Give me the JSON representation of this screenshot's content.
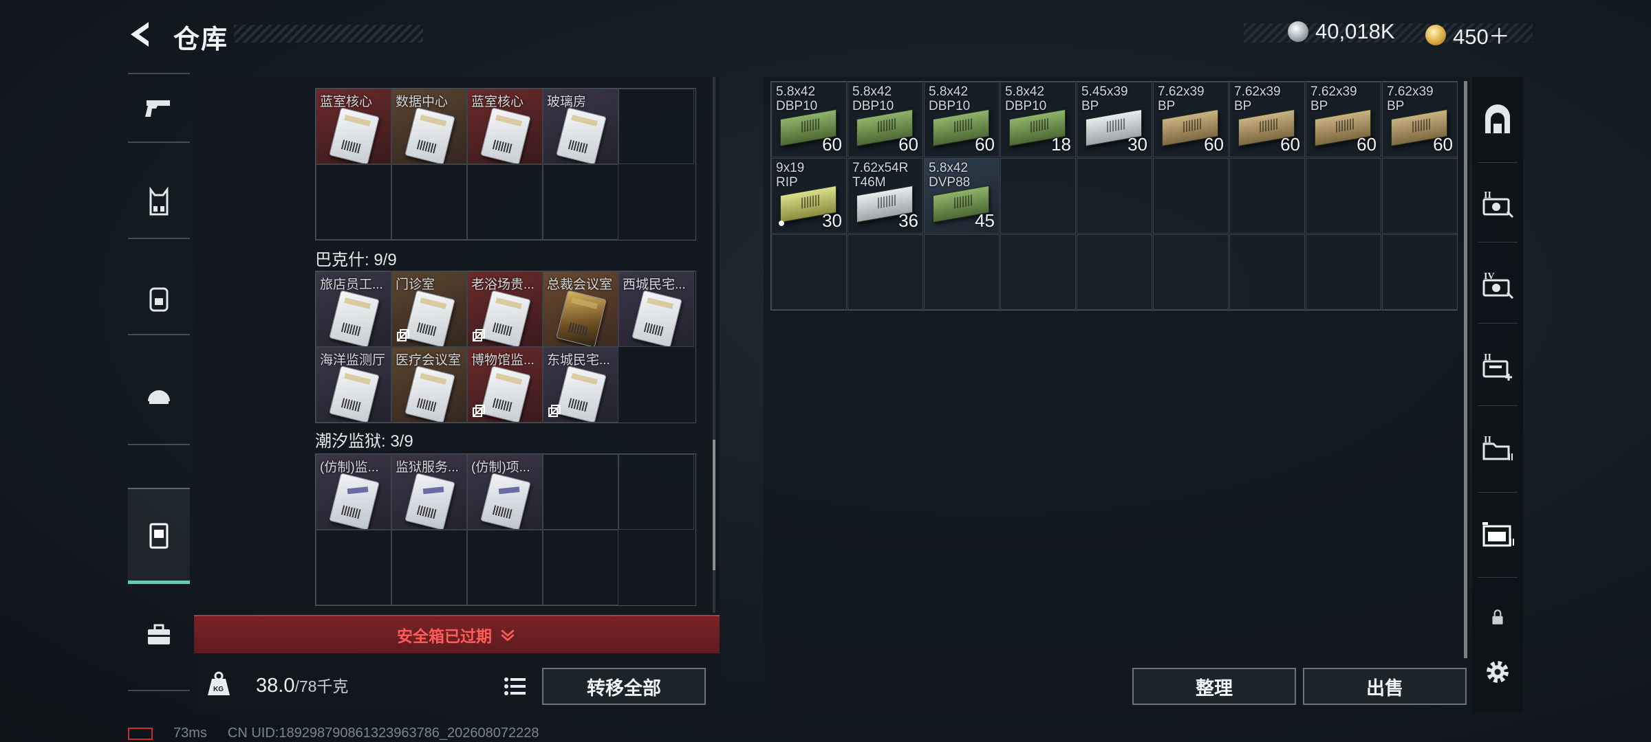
{
  "header": {
    "title": "仓库",
    "currency_silver": "40,018K",
    "currency_gold": "450＋"
  },
  "left_nav": {
    "items": [
      "pistol",
      "vest",
      "backpack",
      "helmet",
      "safe-box",
      "case"
    ],
    "active": "safe-box"
  },
  "safe_box": {
    "section1": {
      "items": [
        {
          "label": "蓝室核心",
          "color": "red"
        },
        {
          "label": "数据中心",
          "color": "brown"
        },
        {
          "label": "蓝室核心",
          "color": "red"
        },
        {
          "label": "玻璃房",
          "color": "purple"
        }
      ]
    },
    "section2": {
      "title": "巴克什: 9/9",
      "items": [
        {
          "label": "旅店员工...",
          "color": "purple",
          "copy": false
        },
        {
          "label": "门诊室",
          "color": "brown",
          "copy": true
        },
        {
          "label": "老浴场贵...",
          "color": "red",
          "copy": true
        },
        {
          "label": "总裁会议室",
          "color": "gold",
          "copy": false
        },
        {
          "label": "西城民宅...",
          "color": "purple",
          "copy": false
        },
        {
          "label": "海洋监测厅",
          "color": "purple",
          "copy": false
        },
        {
          "label": "医疗会议室",
          "color": "brown",
          "copy": false
        },
        {
          "label": "博物馆监...",
          "color": "red",
          "copy": true
        },
        {
          "label": "东城民宅...",
          "color": "purple",
          "copy": true
        }
      ]
    },
    "section3": {
      "title": "潮汐监狱: 3/9",
      "items": [
        {
          "label": "(仿制)监...",
          "color": "purple"
        },
        {
          "label": "监狱服务...",
          "color": "purple"
        },
        {
          "label": "(仿制)项...",
          "color": "purple"
        }
      ]
    },
    "expired_text": "安全箱已过期",
    "weight_current": "38.0",
    "weight_max": "/78千克",
    "weight_icon_text": "KG",
    "transfer_all": "转移全部"
  },
  "warehouse": {
    "items": [
      {
        "label": "5.8x42\nDBP10",
        "count": "60",
        "box": "green"
      },
      {
        "label": "5.8x42\nDBP10",
        "count": "60",
        "box": "green"
      },
      {
        "label": "5.8x42\nDBP10",
        "count": "60",
        "box": "green"
      },
      {
        "label": "5.8x42\nDBP10",
        "count": "18",
        "box": "green"
      },
      {
        "label": "5.45x39\nBP",
        "count": "30",
        "box": "white"
      },
      {
        "label": "7.62x39\nBP",
        "count": "60",
        "box": "tan"
      },
      {
        "label": "7.62x39\nBP",
        "count": "60",
        "box": "tan"
      },
      {
        "label": "7.62x39\nBP",
        "count": "60",
        "box": "tan"
      },
      {
        "label": "7.62x39\nBP",
        "count": "60",
        "box": "tan"
      },
      {
        "label": "9x19\nRIP",
        "count": "30",
        "box": "lime",
        "dot": true
      },
      {
        "label": "7.62x54R\nT46M",
        "count": "36",
        "box": "white"
      },
      {
        "label": "5.8x42\nDVP88",
        "count": "45",
        "box": "green",
        "highlight": true
      }
    ],
    "sort": "整理",
    "sell": "出售"
  },
  "right_nav": {
    "items": [
      "armory-icon",
      "ii-camera-icon",
      "iv-camera-icon",
      "medkit-icon",
      "iii-folder-icon",
      "storage-icon",
      "lock-icon",
      "settings-icon"
    ]
  },
  "footer": {
    "ping": "73ms",
    "uid": "CN UID:1892987908613239637​86_202608072228"
  }
}
